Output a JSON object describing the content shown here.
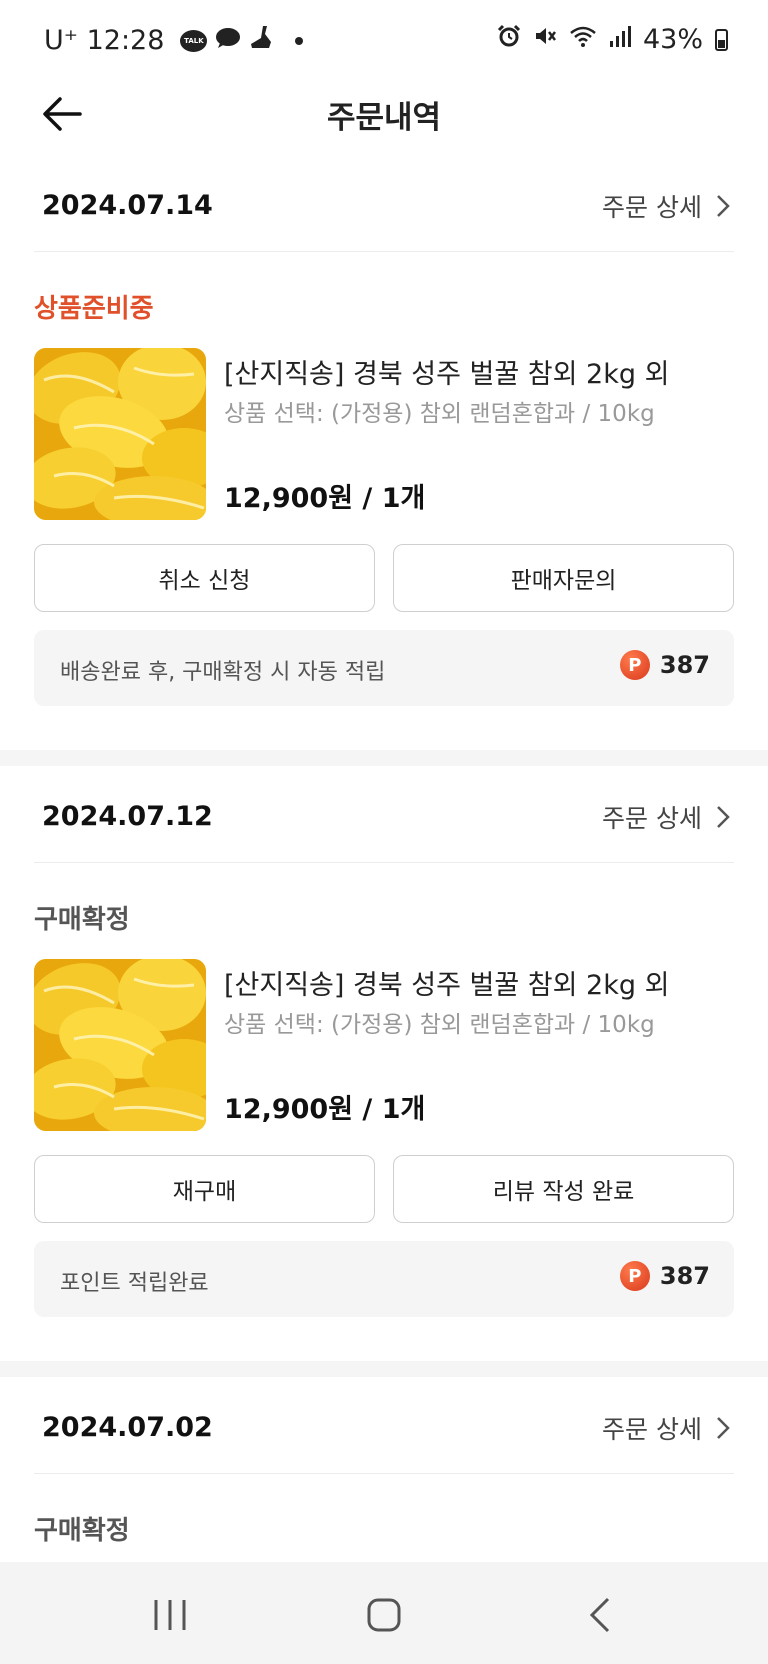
{
  "status_bar": {
    "carrier_time": "U⁺ 12:28",
    "talk_label": "TALK",
    "battery": "43%"
  },
  "header": {
    "title": "주문내역"
  },
  "orders": [
    {
      "date": "2024.07.14",
      "detail_label": "주문 상세",
      "status": "상품준비중",
      "product_name": "[산지직송] 경북 성주 벌꿀 참외 2kg 외",
      "option": "상품 선택: (가정용) 참외 랜덤혼합과 / 10kg",
      "price": "12,900원 / 1개",
      "buttons": [
        "취소 신청",
        "판매자문의"
      ],
      "points_text": "배송완료 후, 구매확정 시 자동 적립",
      "points_badge": "P",
      "points_value": "387"
    },
    {
      "date": "2024.07.12",
      "detail_label": "주문 상세",
      "status": "구매확정",
      "product_name": "[산지직송] 경북 성주 벌꿀 참외 2kg 외",
      "option": "상품 선택: (가정용) 참외 랜덤혼합과 / 10kg",
      "price": "12,900원 / 1개",
      "buttons": [
        "재구매",
        "리뷰 작성 완료"
      ],
      "points_text": "포인트 적립완료",
      "points_badge": "P",
      "points_value": "387"
    },
    {
      "date": "2024.07.02",
      "detail_label": "주문 상세",
      "status": "구매확정"
    }
  ],
  "colors": {
    "status_preparing": "#e0502a",
    "point_badge": "#d9391b",
    "melon": "#f4c51e"
  }
}
